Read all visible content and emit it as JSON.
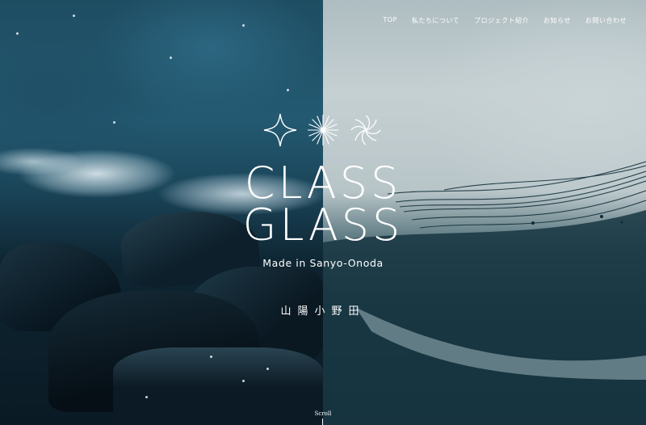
{
  "nav": {
    "items": [
      {
        "label": "TOP"
      },
      {
        "label": "私たちについて"
      },
      {
        "label": "プロジェクト紹介"
      },
      {
        "label": "お知らせ"
      },
      {
        "label": "お問い合わせ"
      }
    ]
  },
  "hero": {
    "title_line1": "CLASS",
    "title_line2": "GLASS",
    "tagline": "Made in Sanyo-Onoda",
    "place_jp": "山陽小野田",
    "scroll_label": "Scroll",
    "icons": [
      "four-point-sparkle-icon",
      "radial-burst-icon",
      "pinwheel-icon"
    ]
  },
  "colors": {
    "text": "#ffffff",
    "ocean_dark": "#0b1e29",
    "ocean_mid": "#235a72",
    "glass_light": "#c5d0d2"
  }
}
